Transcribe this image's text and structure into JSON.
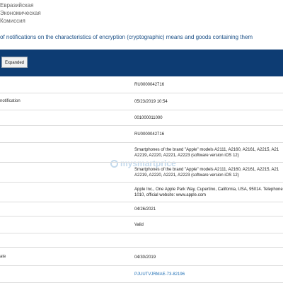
{
  "header": {
    "org_lines": [
      "Евразийская",
      "Экономическая",
      "Комиссия"
    ],
    "title": "of notifications on the characteristics of encryption (cryptographic) means and goods containing them"
  },
  "toolbar": {
    "expanded_label": "Expanded"
  },
  "watermark": "mysmartprice",
  "rows": [
    {
      "label": "",
      "value": "RU0000042716"
    },
    {
      "label": "notification",
      "value": "05/23/2019 10:54"
    },
    {
      "label": "",
      "value": "001000011000"
    },
    {
      "label": "",
      "value": "RU0000042716"
    },
    {
      "label": "",
      "value": "Smartphones of the brand \"Apple\" models A2111, A2160, A2161, A2215, A21\nA2219, A2220, A2221, A2223 (software version iOS 12)"
    },
    {
      "label": "",
      "value": "Smartphones of the brand \"Apple\" models A2111, A2160, A2161, A2215, A21\nA2219, A2220, A2221, A2223 (software version iOS 12)"
    },
    {
      "label": "",
      "value": "Apple Inc., One Apple Park Way, Cupertino, California, USA, 95014. Telephone\n1010, official website: www.apple.com"
    },
    {
      "label": "",
      "value": "04/26/2021"
    },
    {
      "label": "",
      "value": "Valid"
    },
    {
      "label": "",
      "value": ""
    },
    {
      "label": "ate",
      "value": "04/30/2019"
    },
    {
      "label": "",
      "value": "PJUUTVJRMAE-73-82196"
    }
  ]
}
